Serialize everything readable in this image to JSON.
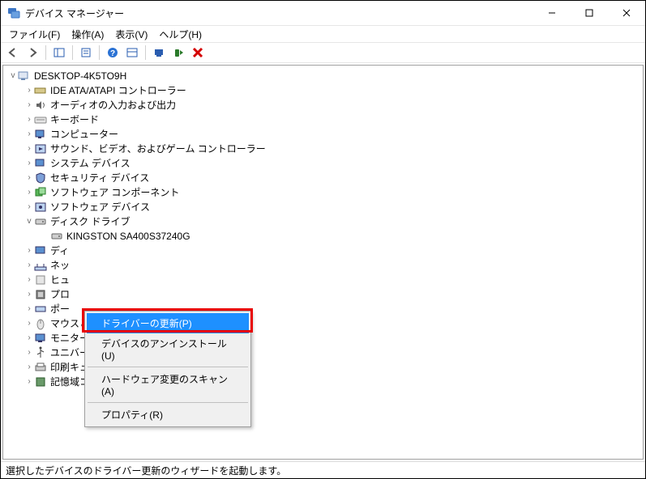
{
  "window": {
    "title": "デバイス マネージャー"
  },
  "menus": {
    "file": "ファイル(F)",
    "action": "操作(A)",
    "view": "表示(V)",
    "help": "ヘルプ(H)"
  },
  "tree": {
    "root": "DESKTOP-4K5TO9H",
    "ide": "IDE ATA/ATAPI コントローラー",
    "audio": "オーディオの入力および出力",
    "keyboard": "キーボード",
    "computer": "コンピューター",
    "svg": "サウンド、ビデオ、およびゲーム コントローラー",
    "system": "システム デバイス",
    "security": "セキュリティ デバイス",
    "sw_component": "ソフトウェア コンポーネント",
    "sw_device": "ソフトウェア デバイス",
    "disk": "ディスク ドライブ",
    "disk_item": "KINGSTON SA400S37240G",
    "display": "ディ",
    "network": "ネッ",
    "hid": "ヒュ",
    "proc": "プロ",
    "port": "ポー",
    "mouse": "マウスとそのほかのポインティング デバイス",
    "monitor": "モニター",
    "usb": "ユニバーサル シリアル バス コントローラー",
    "printqueue": "印刷キュー",
    "storage": "記憶域コントローラー"
  },
  "context_menu": {
    "update": "ドライバーの更新(P)",
    "uninstall": "デバイスのアンインストール(U)",
    "scan": "ハードウェア変更のスキャン(A)",
    "properties": "プロパティ(R)"
  },
  "statusbar": "選択したデバイスのドライバー更新のウィザードを起動します。"
}
